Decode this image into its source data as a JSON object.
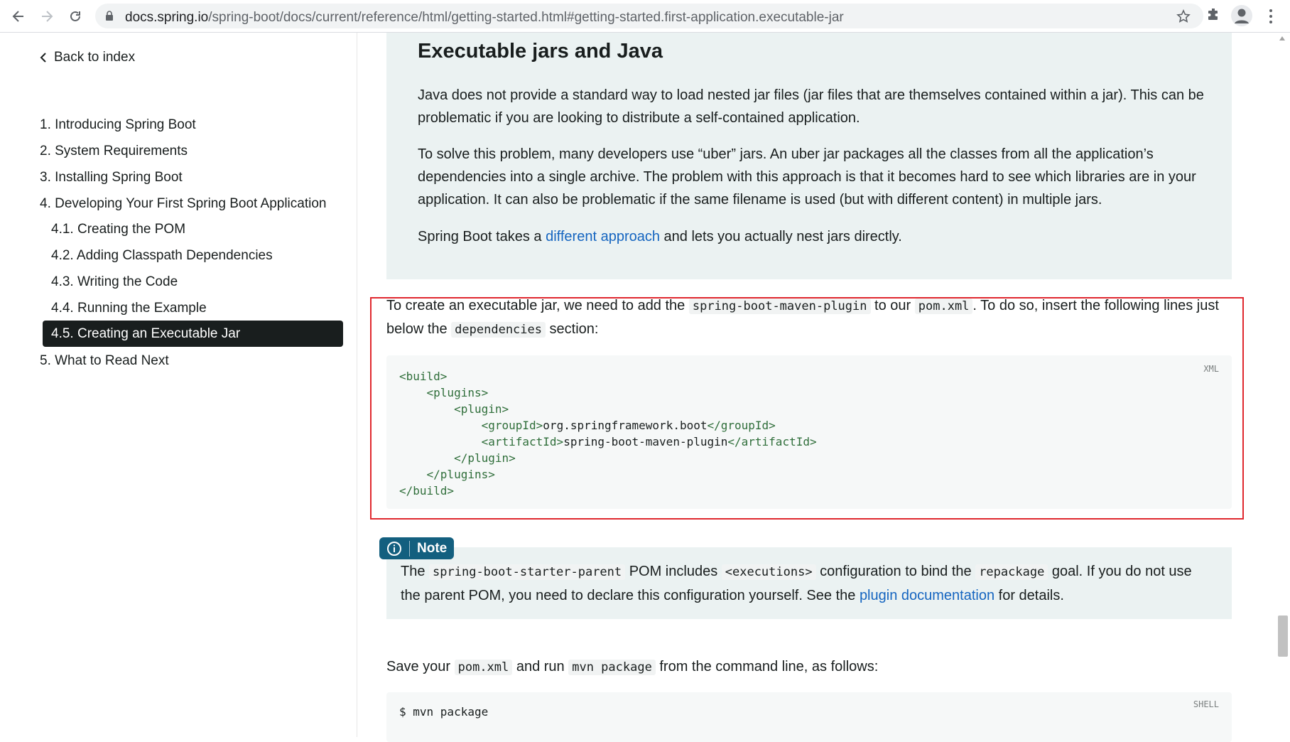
{
  "browser": {
    "url_host": "docs.spring.io",
    "url_path": "/spring-boot/docs/current/reference/html/getting-started.html#getting-started.first-application.executable-jar",
    "icons": [
      "back-icon",
      "forward-icon",
      "reload-icon",
      "lock-icon",
      "star-icon",
      "extensions-icon",
      "profile-icon",
      "menu-icon"
    ]
  },
  "sidebar": {
    "back_label": "Back to index",
    "items": [
      {
        "label": "1. Introducing Spring Boot"
      },
      {
        "label": "2. System Requirements"
      },
      {
        "label": "3. Installing Spring Boot"
      },
      {
        "label": "4. Developing Your First Spring Boot Application"
      },
      {
        "label": "4.1. Creating the POM"
      },
      {
        "label": "4.2. Adding Classpath Dependencies"
      },
      {
        "label": "4.3. Writing the Code"
      },
      {
        "label": "4.4. Running the Example"
      },
      {
        "label": "4.5. Creating an Executable Jar",
        "active": true
      },
      {
        "label": "5. What to Read Next"
      }
    ]
  },
  "sidebar_section": {
    "title": "Executable jars and Java",
    "p1_line1": "Java does not provide a standard way to load nested jar files (jar files that are themselves contained within a jar). This can be",
    "p1_line2": "problematic if you are looking to distribute a self-contained application.",
    "p2_line1": "To solve this problem, many developers use “uber” jars. An uber jar packages all the classes from all the application’s",
    "p2_line2": "dependencies into a single archive. The problem with this approach is that it becomes hard to see which libraries are in your",
    "p2_line3": "application. It can also be problematic if the same filename is used (but with different content) in multiple jars.",
    "p3_before": "Spring Boot takes a ",
    "p3_link": "different approach",
    "p3_after": " and lets you actually nest jars directly."
  },
  "main": {
    "intro_a": "To create an executable jar, we need to add the ",
    "intro_code1": "spring-boot-maven-plugin",
    "intro_b": " to our ",
    "intro_code2": "pom.xml",
    "intro_c": ". To do so, insert the following lines just",
    "intro_d": "below the ",
    "intro_code3": "dependencies",
    "intro_e": " section:",
    "code_lang": "XML",
    "code_lines": {
      "l1": "<build>",
      "l2": "<plugins>",
      "l3": "<plugin>",
      "l4_open": "<groupId>",
      "l4_text": "org.springframework.boot",
      "l4_close": "</groupId>",
      "l5_open": "<artifactId>",
      "l5_text": "spring-boot-maven-plugin",
      "l5_close": "</artifactId>",
      "l6": "</plugin>",
      "l7": "</plugins>",
      "l8": "</build>"
    },
    "note_label": "Note",
    "note_a": "The ",
    "note_code1": "spring-boot-starter-parent",
    "note_b": " POM includes ",
    "note_code2": "<executions>",
    "note_c": " configuration to bind the ",
    "note_code3": "repackage",
    "note_d": " goal. If you do not use",
    "note_e": "the parent POM, you need to declare this configuration yourself. See the ",
    "note_link": "plugin documentation",
    "note_f": " for details.",
    "save_a": "Save your ",
    "save_code1": "pom.xml",
    "save_b": " and run ",
    "save_code2": "mvn package",
    "save_c": " from the command line, as follows:",
    "shell_lang": "SHELL",
    "shell_cmd": "$ mvn package"
  },
  "colors": {
    "accent": "#1565c0",
    "highlight_border": "#e0282e",
    "note_badge": "#135f7f",
    "panel_bg": "#ebf2f2"
  }
}
